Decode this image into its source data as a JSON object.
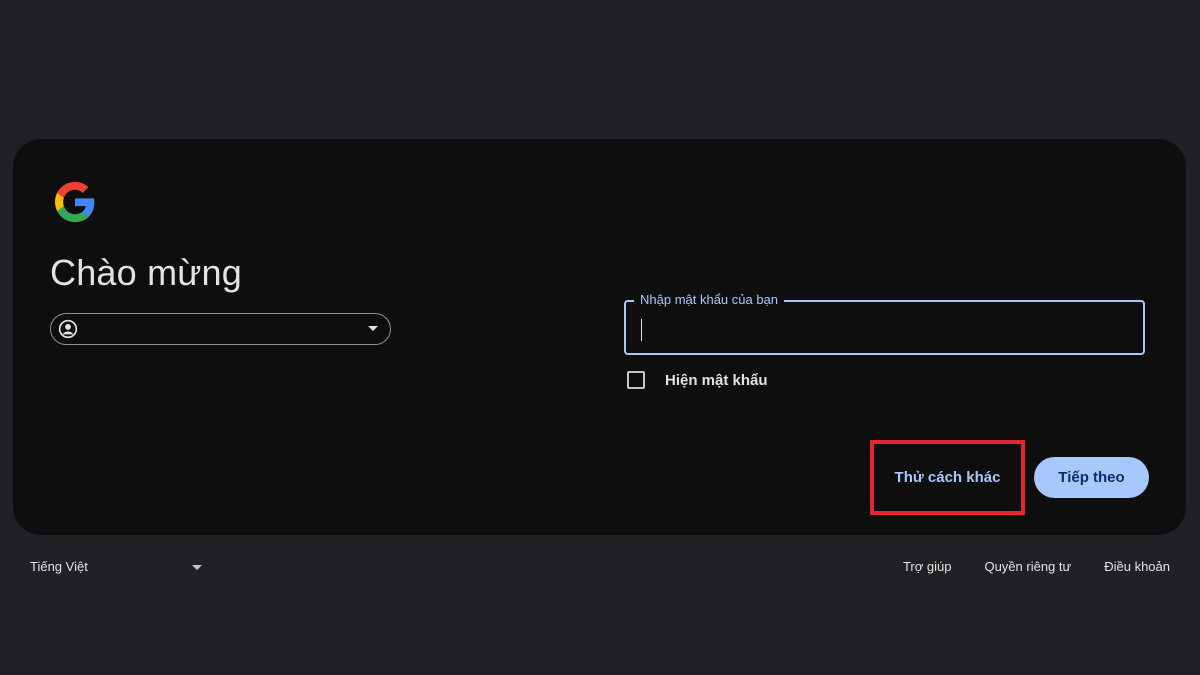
{
  "card": {
    "title": "Chào mừng",
    "logo_icon": "google-g-logo",
    "account_chip": {
      "avatar_icon": "account-circle-icon",
      "dropdown_icon": "caret-down-icon"
    },
    "password": {
      "label": "Nhập mật khẩu của bạn",
      "value": "",
      "focused": true
    },
    "show_password": {
      "label": "Hiện mật khẩu",
      "checked": false
    },
    "buttons": {
      "try_another": "Thử cách khác",
      "next": "Tiếp theo"
    }
  },
  "footer": {
    "language": "Tiếng Việt",
    "links": [
      "Trợ giúp",
      "Quyền riêng tư",
      "Điều khoản"
    ]
  },
  "colors": {
    "page_bg": "#202124",
    "card_bg": "#0e0e0f",
    "accent": "#a8c7fa",
    "highlight_box": "#e5262e"
  }
}
